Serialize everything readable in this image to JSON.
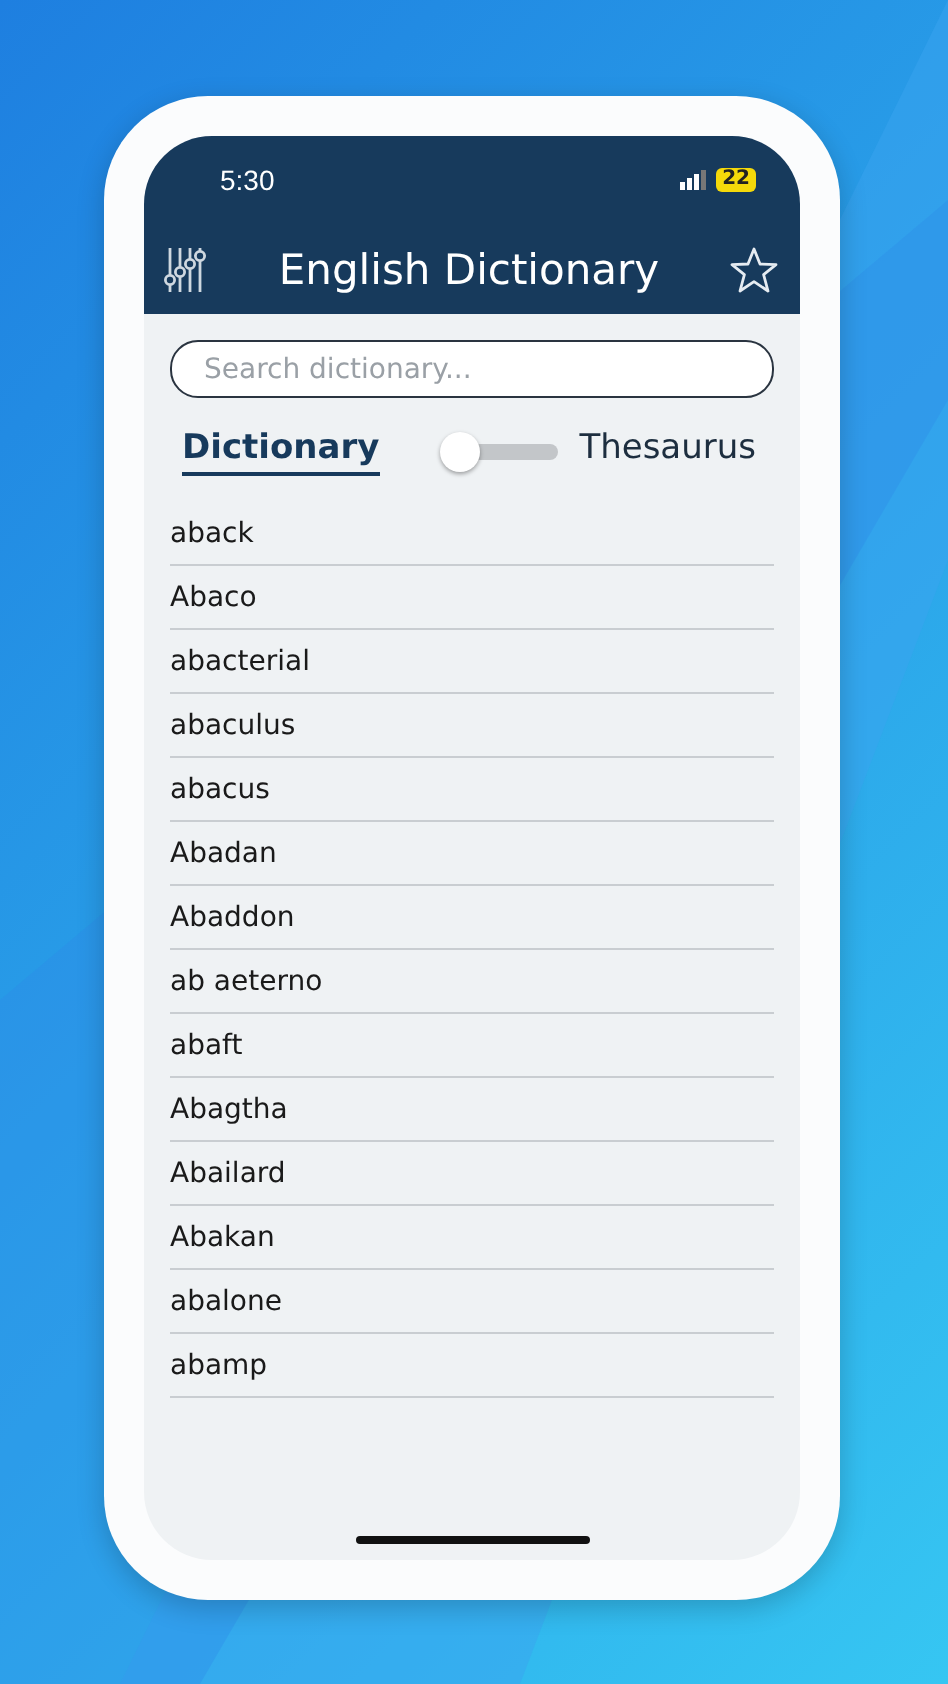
{
  "status_bar": {
    "time": "5:30",
    "battery": "22"
  },
  "header": {
    "title": "English Dictionary"
  },
  "search": {
    "placeholder": "Search dictionary..."
  },
  "modes": [
    {
      "label": "Dictionary",
      "selected": true
    },
    {
      "label": "Thesaurus",
      "selected": false
    }
  ],
  "mode_switch": {
    "on": false
  },
  "words": [
    "aback",
    "Abaco",
    "abacterial",
    "abaculus",
    "abacus",
    "Abadan",
    "Abaddon",
    "ab aeterno",
    "abaft",
    "Abagtha",
    "Abailard",
    "Abakan",
    "abalone",
    "abamp"
  ]
}
